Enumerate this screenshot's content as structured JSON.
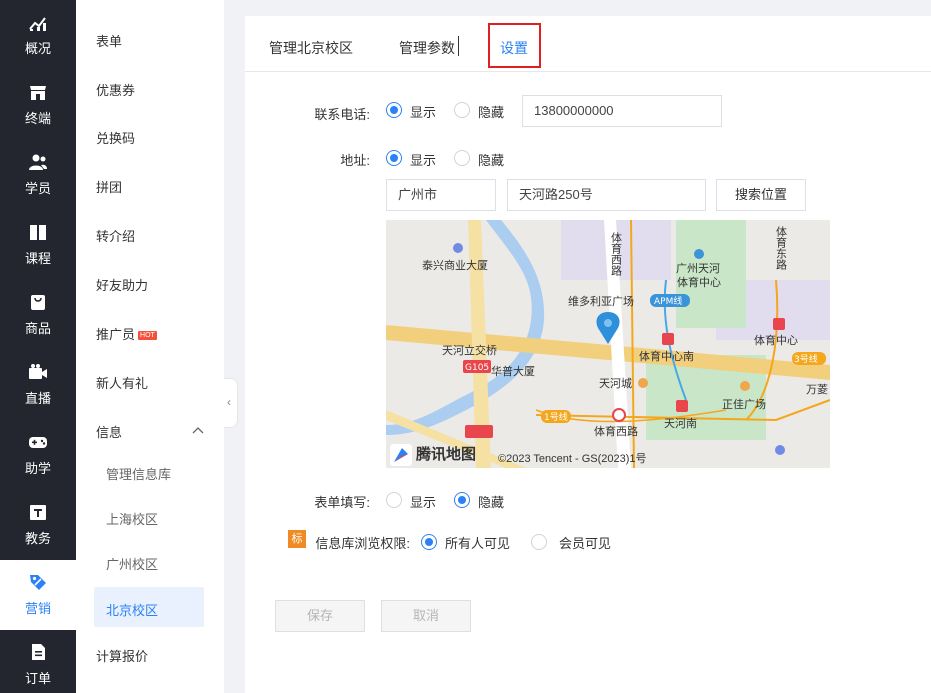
{
  "rail": {
    "items": [
      {
        "label": "概况",
        "icon": "chart-icon"
      },
      {
        "label": "终端",
        "icon": "store-icon"
      },
      {
        "label": "学员",
        "icon": "users-icon"
      },
      {
        "label": "课程",
        "icon": "book-icon"
      },
      {
        "label": "商品",
        "icon": "bag-icon"
      },
      {
        "label": "直播",
        "icon": "video-icon"
      },
      {
        "label": "助学",
        "icon": "gamepad-icon"
      },
      {
        "label": "教务",
        "icon": "calendar-icon"
      },
      {
        "label": "营销",
        "icon": "tag-icon"
      },
      {
        "label": "订单",
        "icon": "document-icon"
      }
    ],
    "active_label": "营销"
  },
  "submenu": {
    "items": [
      "表单",
      "优惠券",
      "兑换码",
      "拼团",
      "转介绍",
      "好友助力",
      "推广员",
      "新人有礼",
      "信息",
      "计算报价"
    ],
    "hot_badge": "HOT",
    "info_children": [
      "管理信息库",
      "上海校区",
      "广州校区",
      "北京校区"
    ]
  },
  "tabs": [
    "管理北京校区",
    "管理参数",
    "设置"
  ],
  "form": {
    "phone_label": "联系电话:",
    "address_label": "地址:",
    "form_fill_label": "表单填写:",
    "browse_label": "信息库浏览权限:",
    "browse_tag": "标",
    "show": "显示",
    "hide": "隐藏",
    "phone_value": "13800000000",
    "city_value": "广州市",
    "street_value": "天河路250号",
    "search_button": "搜索位置",
    "all_visible": "所有人可见",
    "member_visible": "会员可见"
  },
  "map": {
    "labels": [
      "泰兴商业大厦",
      "广州天河",
      "体育中心",
      "维多利亚广场",
      "APM线",
      "天河立交桥",
      "华普大厦",
      "G105",
      "天河城",
      "体育中心南",
      "体育中心",
      "3号线",
      "万菱",
      "1号线",
      "体育西路",
      "天河南",
      "正佳广场",
      "体育西路",
      "体育东路",
      "腾讯地图",
      "©2023 Tencent - GS(2023)1号"
    ],
    "logo_text": "腾讯地图",
    "copyright": "©2023 Tencent - GS(2023)1号"
  },
  "actions": {
    "save": "保存",
    "cancel": "取消"
  }
}
